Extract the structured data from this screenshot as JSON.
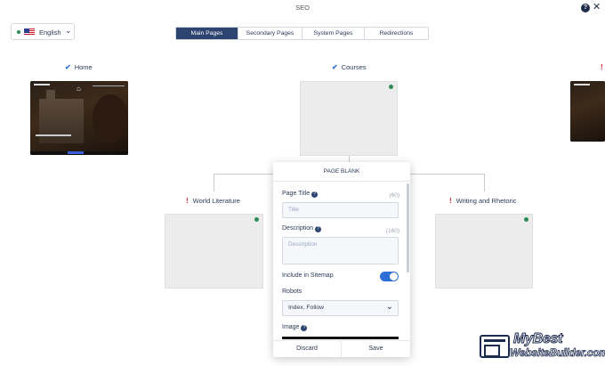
{
  "window": {
    "title": "SEO"
  },
  "language": {
    "label": "English"
  },
  "tabs": [
    {
      "label": "Main Pages",
      "active": true
    },
    {
      "label": "Secondary Pages",
      "active": false
    },
    {
      "label": "System Pages",
      "active": false
    },
    {
      "label": "Redirections",
      "active": false
    }
  ],
  "pages": {
    "home": {
      "label": "Home",
      "status": "check"
    },
    "courses": {
      "label": "Courses",
      "status": "check"
    },
    "world_literature": {
      "label": "World Literature",
      "status": "warning"
    },
    "writing_rhetoric": {
      "label": "Writing and Rhetoric",
      "status": "warning"
    }
  },
  "modal": {
    "heading": "PAGE BLANK",
    "page_title_label": "Page Title",
    "page_title_count": "(60)",
    "page_title_placeholder": "Title",
    "description_label": "Description",
    "description_count": "(160)",
    "description_placeholder": "Description",
    "sitemap_label": "Include in Sitemap",
    "sitemap_on": true,
    "robots_label": "Robots",
    "robots_value": "Index, Follow",
    "image_label": "Image",
    "discard_label": "Discard",
    "save_label": "Save"
  },
  "watermark": {
    "line1": "MyBest",
    "line2": "WebsiteBuilder.com"
  },
  "colors": {
    "accent": "#2e4470",
    "toggle": "#2d6fd6",
    "ok": "#2e8b57",
    "warning": "#d3242e"
  }
}
